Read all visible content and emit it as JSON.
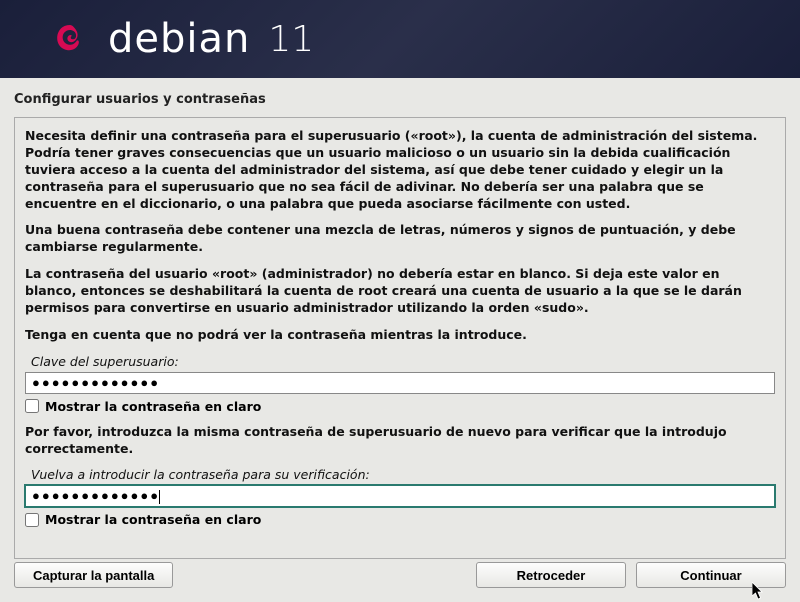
{
  "header": {
    "brand": "debian",
    "version": "11"
  },
  "page_title": "Configurar usuarios y contraseñas",
  "paragraphs": {
    "p1": "Necesita definir una contraseña para el superusuario («root»), la cuenta de administración del sistema. Podría tener graves consecuencias que un usuario malicioso o un usuario sin la debida cualificación tuviera acceso a la cuenta del administrador del sistema, así que debe tener cuidado y elegir un la contraseña para el superusuario que no sea fácil de adivinar. No debería ser una palabra que se encuentre en el diccionario, o una palabra que pueda asociarse fácilmente con usted.",
    "p2": "Una buena contraseña debe contener una mezcla de letras, números y signos de puntuación, y debe cambiarse regularmente.",
    "p3": "La contraseña del usuario «root» (administrador) no debería estar en blanco. Si deja este valor en blanco, entonces se deshabilitará la cuenta de root creará una cuenta de usuario a la que se le darán permisos para convertirse en usuario administrador utilizando la orden «sudo».",
    "p4": "Tenga en cuenta que no podrá ver la contraseña mientras la introduce."
  },
  "field1": {
    "label": "Clave del superusuario:",
    "value_masked": "●●●●●●●●●●●●●",
    "show_label": "Mostrar la contraseña en claro",
    "show_checked": false
  },
  "confirm_prompt": "Por favor, introduzca la misma contraseña de superusuario de nuevo para verificar que la introdujo correctamente.",
  "field2": {
    "label": "Vuelva a introducir la contraseña para su verificación:",
    "value_masked": "●●●●●●●●●●●●●",
    "show_label": "Mostrar la contraseña en claro",
    "show_checked": false,
    "focused": true
  },
  "buttons": {
    "screenshot": "Capturar la pantalla",
    "back": "Retroceder",
    "continue": "Continuar"
  }
}
